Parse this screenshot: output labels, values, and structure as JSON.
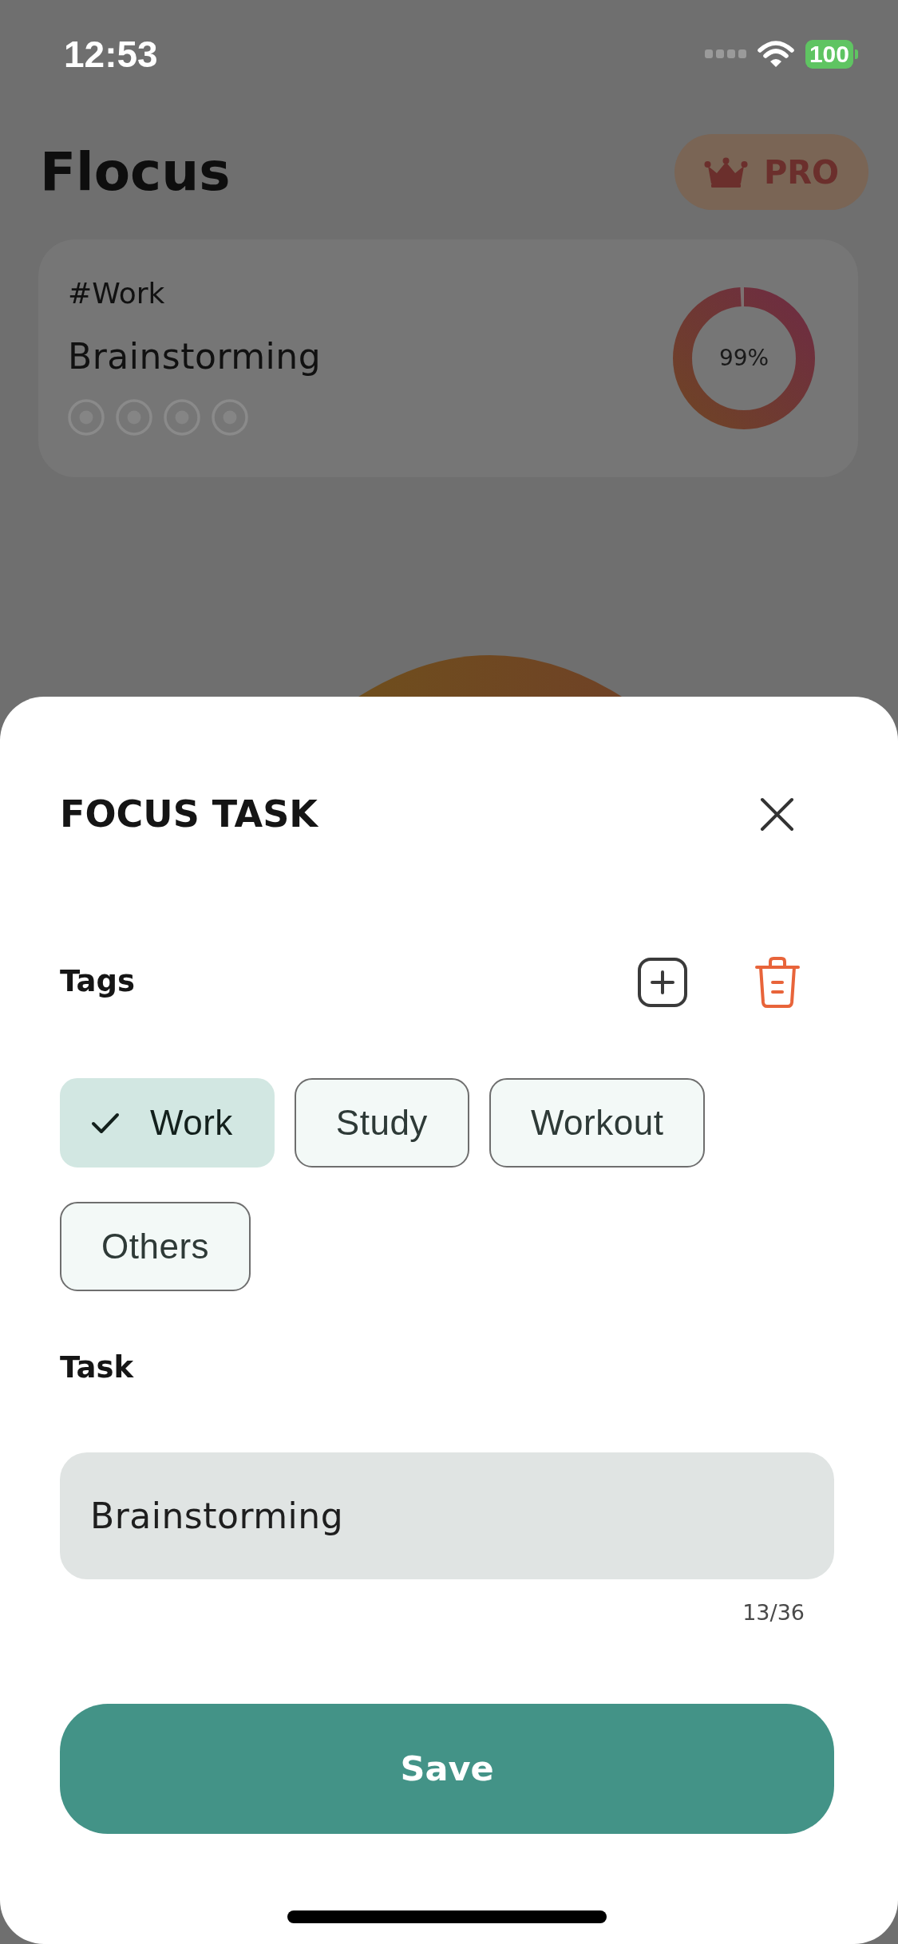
{
  "status_bar": {
    "time": "12:53",
    "battery": "100"
  },
  "header": {
    "title": "Flocus",
    "pro_badge": "PRO"
  },
  "current_task": {
    "tag": "#Work",
    "name": "Brainstorming",
    "sessions": [
      {
        "completed": false
      },
      {
        "completed": false
      },
      {
        "completed": false
      },
      {
        "completed": false
      }
    ],
    "progress": {
      "level": 0.99,
      "label": "99%"
    }
  },
  "sheet": {
    "title": "FOCUS TASK",
    "tags_label": "Tags",
    "tags": [
      {
        "label": "Work",
        "selected": true
      },
      {
        "label": "Study",
        "selected": false
      },
      {
        "label": "Workout",
        "selected": false
      },
      {
        "label": "Others",
        "selected": false
      }
    ],
    "task_label": "Task",
    "task_input": {
      "value": "Brainstorming",
      "counter": "13/36"
    },
    "save_button": "Save"
  }
}
